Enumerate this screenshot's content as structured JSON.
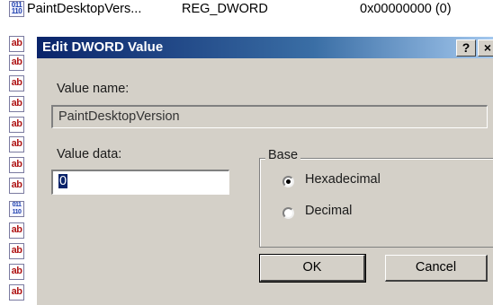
{
  "registry": {
    "header_row": {
      "name": "PaintDesktopVers...",
      "type": "REG_DWORD",
      "data": "0x00000000 (0)",
      "icon": "reg-binary-icon"
    },
    "left_icons": [
      "ab",
      "ab",
      "ab",
      "ab",
      "ab",
      "ab",
      "ab",
      "bin",
      "ab",
      "ab",
      "ab",
      "ab"
    ]
  },
  "dialog": {
    "title": "Edit DWORD Value",
    "help_label": "?",
    "close_label": "×",
    "value_name_label": "Value name:",
    "value_name": "PaintDesktopVersion",
    "value_data_label": "Value data:",
    "value_data": "0",
    "base": {
      "title": "Base",
      "options": [
        {
          "label": "Hexadecimal",
          "selected": true
        },
        {
          "label": "Decimal",
          "selected": false
        }
      ]
    },
    "ok_label": "OK",
    "cancel_label": "Cancel"
  },
  "colors": {
    "title_start": "#0a246a",
    "title_end": "#a6caf0",
    "face": "#d4d0c8"
  }
}
